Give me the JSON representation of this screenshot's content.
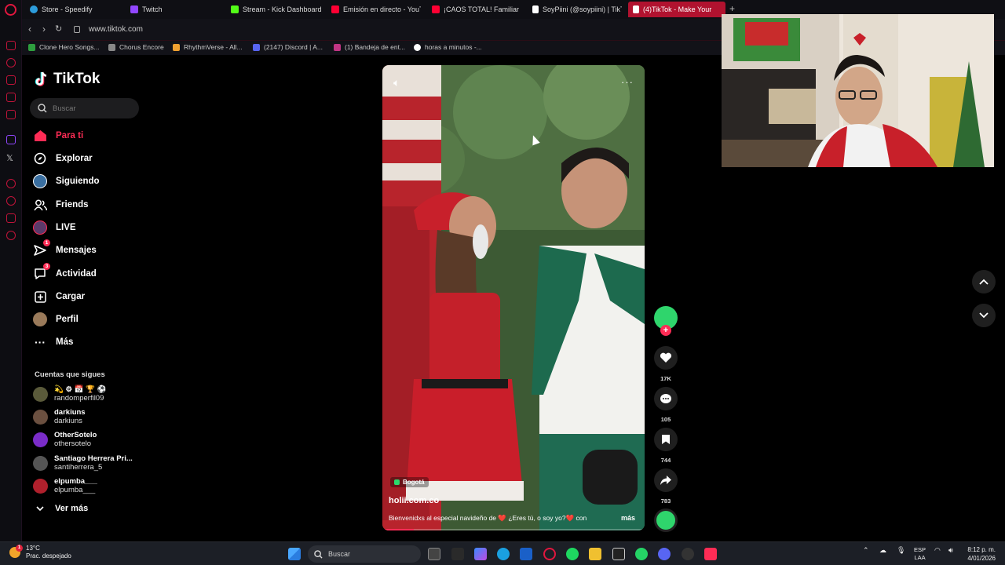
{
  "browser": {
    "tabs": [
      {
        "label": "Store - Speedify",
        "color": "#2d9cdb"
      },
      {
        "label": "Twitch",
        "color": "#9146ff"
      },
      {
        "label": "Stream - Kick Dashboard",
        "color": "#53fc18"
      },
      {
        "label": "Emisión en directo - YouTu",
        "color": "#ff0033"
      },
      {
        "label": "¡CAOS TOTAL! Familiar",
        "color": "#ff0033"
      },
      {
        "label": "SoyPiini (@soypiini) | TikT",
        "color": "#ffffff"
      },
      {
        "label": "(4)TikTok - Make Your",
        "color": "#ffffff"
      }
    ],
    "url": "www.tiktok.com",
    "bookmarks": [
      {
        "label": "Clone Hero Songs...",
        "color": "#2e9e3e"
      },
      {
        "label": "Chorus Encore",
        "color": "#888888"
      },
      {
        "label": "RhythmVerse - All...",
        "color": "#f0a030"
      },
      {
        "label": "(2147) Discord | A...",
        "color": "#5865f2"
      },
      {
        "label": "(1) Bandeja de ent...",
        "color": "#c13584"
      },
      {
        "label": "horas a minutos -...",
        "color": "#ffffff"
      }
    ]
  },
  "tiktok": {
    "logo": "TikTok",
    "search_placeholder": "Buscar",
    "menu": [
      {
        "label": "Para ti",
        "icon": "home-icon",
        "active": true
      },
      {
        "label": "Explorar",
        "icon": "compass-icon"
      },
      {
        "label": "Siguiendo",
        "icon": "following-avatar-icon"
      },
      {
        "label": "Friends",
        "icon": "friends-icon"
      },
      {
        "label": "LIVE",
        "icon": "live-avatar-icon"
      },
      {
        "label": "Mensajes",
        "icon": "send-icon",
        "badge": "1"
      },
      {
        "label": "Actividad",
        "icon": "activity-icon",
        "badge": "3"
      },
      {
        "label": "Cargar",
        "icon": "upload-icon"
      },
      {
        "label": "Perfil",
        "icon": "profile-avatar-icon"
      },
      {
        "label": "Más",
        "icon": "more-icon"
      }
    ],
    "following_title": "Cuentas que sigues",
    "following": [
      {
        "name": "💫 ⚙ 📅 🏆 ⚽",
        "handle": "randomperfil09",
        "color": "#5a5a3a"
      },
      {
        "name": "darkiuns",
        "handle": "darkiuns",
        "color": "#6b5040"
      },
      {
        "name": "OtherSotelo",
        "handle": "othersotelo",
        "color": "#7a2cc8"
      },
      {
        "name": "Santiago Herrera Pri...",
        "handle": "santiherrera_5",
        "color": "#555555"
      },
      {
        "name": "elpumba___",
        "handle": "elpumba___",
        "color": "#b0202c"
      }
    ],
    "see_more": "Ver más",
    "video": {
      "location": "Bogotá",
      "author": "holii.com.co",
      "caption": "Bienvenidxs al especial navideño de ❤️ ¿Eres tú, o soy yo?❤️ con",
      "more": "más",
      "progress": 0.12
    },
    "actions": {
      "likes": "17K",
      "comments": "105",
      "saves": "744",
      "shares": "783"
    }
  },
  "taskbar": {
    "weather_temp": "13°C",
    "weather_desc": "Prac. despejado",
    "weather_badge": "1",
    "search": "Buscar",
    "lang": "ESP",
    "lang2": "LAA",
    "time": "8:12 p. m.",
    "date": "4/01/2026"
  }
}
